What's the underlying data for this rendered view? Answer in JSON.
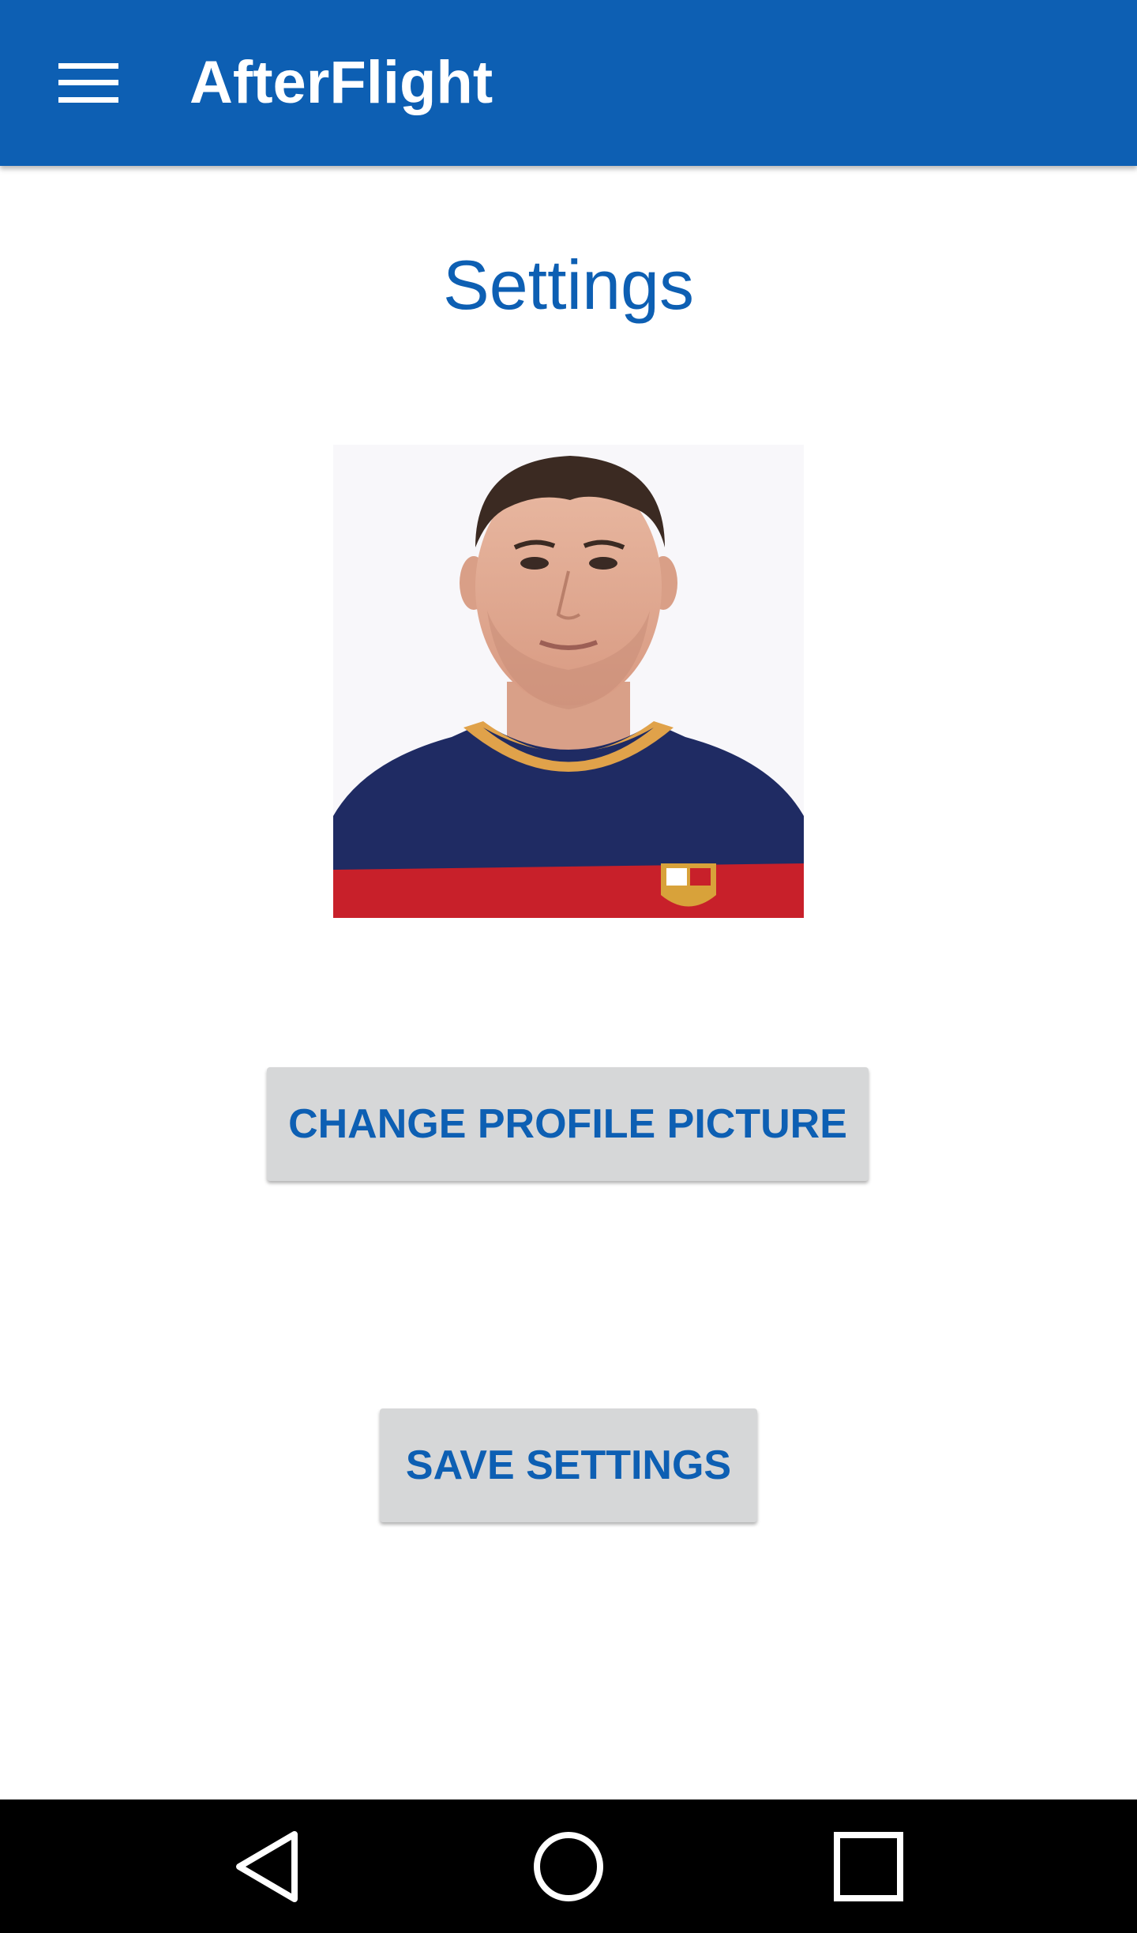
{
  "app_bar": {
    "title": "AfterFlight",
    "menu_icon": "hamburger-menu-icon",
    "background_color": "#0d5fb3"
  },
  "page": {
    "title": "Settings",
    "title_color": "#0d5fb3"
  },
  "profile": {
    "photo_description": "profile-picture"
  },
  "buttons": {
    "change_picture": "CHANGE PROFILE PICTURE",
    "save_settings": "SAVE SETTINGS"
  },
  "nav_bar": {
    "back_icon": "back-triangle-icon",
    "home_icon": "home-circle-icon",
    "recents_icon": "recents-square-icon"
  }
}
